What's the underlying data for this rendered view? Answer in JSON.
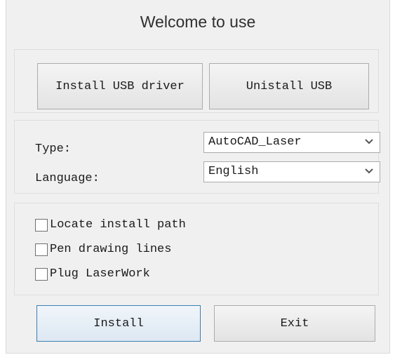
{
  "window": {
    "title": "Welcome to use"
  },
  "usb": {
    "install_label": "Install USB driver",
    "uninstall_label": "Unistall USB"
  },
  "settings": {
    "type_label": "Type:",
    "type_value": "AutoCAD_Laser",
    "language_label": "Language:",
    "language_value": "English"
  },
  "options": {
    "items": [
      {
        "label": "Locate install path",
        "checked": false
      },
      {
        "label": "Pen drawing lines",
        "checked": false
      },
      {
        "label": "Plug LaserWork",
        "checked": false
      }
    ]
  },
  "actions": {
    "install_label": "Install",
    "exit_label": "Exit"
  },
  "colors": {
    "focus_border": "#3c7fb1",
    "window_bg": "#f0f0f0"
  },
  "icons": {
    "dropdown": "chevron-down-icon"
  }
}
